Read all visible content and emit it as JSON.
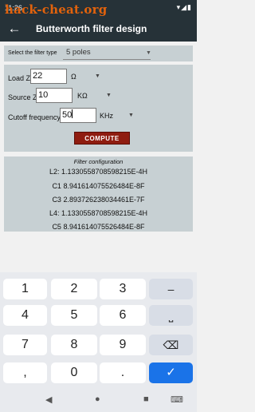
{
  "status_bar": {
    "time": "11:26",
    "left_icons": "▯ S ·",
    "right_icons": "▾◢▮",
    "watermark": "hack-cheat.org"
  },
  "app_bar": {
    "back_icon": "arrow-left-icon",
    "title": "Butterworth filter design"
  },
  "filter_type": {
    "label": "Select the filter type",
    "value": "5 poles"
  },
  "params": {
    "load": {
      "label": "Load Z",
      "value": "22",
      "unit": "Ω"
    },
    "source": {
      "label": "Source Z",
      "value": "10",
      "unit": "KΩ"
    },
    "cutoff": {
      "label": "Cutoff frequency",
      "value": "50",
      "unit": "KHz"
    }
  },
  "compute_label": "COMPUTE",
  "results": {
    "title": "Filter configuration",
    "lines": [
      "L2: 1.1330558708598215E-4H",
      "C1 8.941614075526484E-8F",
      "C3 2.893726238034461E-7F",
      "L4: 1.1330558708598215E-4H",
      "C5 8.941614075526484E-8F"
    ]
  },
  "keyboard": {
    "rows": [
      [
        "1",
        "2",
        "3",
        "–"
      ],
      [
        "4",
        "5",
        "6",
        "⎵"
      ],
      [
        "7",
        "8",
        "9",
        "⌫"
      ],
      [
        ",",
        "0",
        ".",
        "✓"
      ]
    ]
  },
  "nav": {
    "back": "◀",
    "home": "●",
    "recents": "■",
    "keyboard": "⌨"
  }
}
